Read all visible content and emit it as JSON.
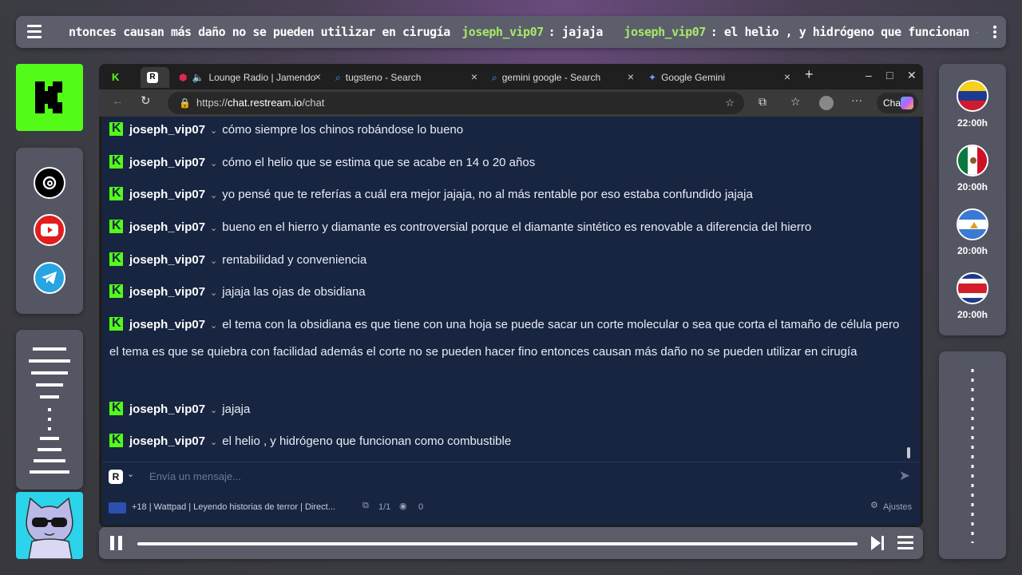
{
  "ticker": {
    "segments": [
      {
        "user": "",
        "text": "ntonces causan más daño no se pueden utilizar en cirugía"
      },
      {
        "user": "joseph_vip07",
        "text": ": jajaja"
      },
      {
        "user": "joseph_vip07",
        "text": ": el helio , y hidrógeno que funcionan como combustible"
      }
    ]
  },
  "right_panel": {
    "times": [
      {
        "flag": "venezuela-flag",
        "label": "22:00h"
      },
      {
        "flag": "mexico-flag",
        "label": "20:00h"
      },
      {
        "flag": "nicaragua-flag",
        "label": "20:00h"
      },
      {
        "flag": "costa-rica-flag",
        "label": "20:00h"
      }
    ]
  },
  "browser": {
    "tabs": [
      {
        "label": "Lounge Radio | Jamendo"
      },
      {
        "label": "tugsteno - Search"
      },
      {
        "label": "gemini google - Search"
      },
      {
        "label": "Google Gemini"
      }
    ],
    "url": {
      "prefix": "https://",
      "host": "chat.restream.io",
      "path": "/chat"
    },
    "chat_button": "Chat"
  },
  "chat": {
    "messages": [
      {
        "user": "joseph_vip07",
        "text": "cómo siempre los chinos robándose lo bueno"
      },
      {
        "user": "joseph_vip07",
        "text": "cómo el helio que se estima que se acabe en 14 o 20 años"
      },
      {
        "user": "joseph_vip07",
        "text": "yo pensé que te referías a cuál era mejor jajaja, no al más rentable por eso estaba confundido jajaja"
      },
      {
        "user": "joseph_vip07",
        "text": "bueno en el hierro y diamante es controversial porque el diamante sintético es renovable a diferencia del hierro"
      },
      {
        "user": "joseph_vip07",
        "text": "rentabilidad y conveniencia"
      },
      {
        "user": "joseph_vip07",
        "text": "jajaja las ojas de obsidiana"
      },
      {
        "user": "joseph_vip07",
        "text": "el tema con la obsidiana es que tiene con una hoja se puede sacar un corte molecular o sea que corta el tamaño de célula pero el tema es que se quiebra con facilidad además el corte no se pueden hacer fino entonces causan más daño no se pueden utilizar en cirugía"
      },
      {
        "user": "joseph_vip07",
        "text": "jajaja"
      },
      {
        "user": "joseph_vip07",
        "text": "el helio , y hidrógeno que funcionan como combustible"
      }
    ],
    "input_badge": "R",
    "input_placeholder": "Envía un mensaje...",
    "footer": {
      "stream_title": "+18 | Wattpad | Leyendo historias de terror | Direct...",
      "count": "1/1",
      "viewers": "0",
      "settings_label": "Ajustes"
    }
  },
  "player": {
    "progress": 1.0
  },
  "colors": {
    "kick_green": "#53fc18",
    "chat_bg": "#172541",
    "ticker_user": "#a6e86a"
  }
}
